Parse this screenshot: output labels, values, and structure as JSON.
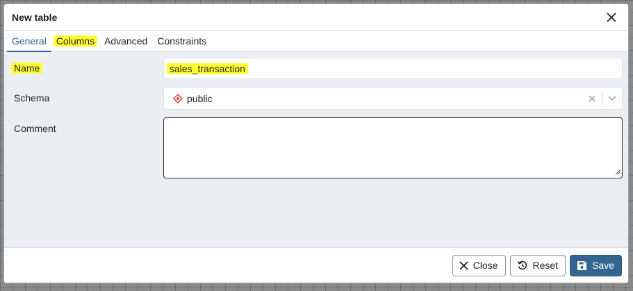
{
  "dialog": {
    "title": "New table",
    "close_icon": "close-icon"
  },
  "tabs": [
    {
      "label": "General",
      "active": true
    },
    {
      "label": "Columns",
      "highlighted": true
    },
    {
      "label": "Advanced"
    },
    {
      "label": "Constraints"
    }
  ],
  "form": {
    "name_label": "Name",
    "name_value": "sales_transaction",
    "schema_label": "Schema",
    "schema_value": "public",
    "schema_icon": "schema-icon",
    "comment_label": "Comment",
    "comment_value": ""
  },
  "footer": {
    "close_label": "Close",
    "reset_label": "Reset",
    "save_label": "Save"
  },
  "colors": {
    "accent": "#326690",
    "highlight": "#ffff33",
    "schema_icon": "#d9342b"
  }
}
